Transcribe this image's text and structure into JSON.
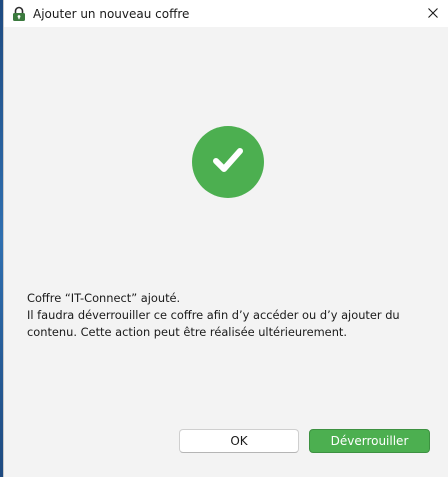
{
  "window": {
    "title": "Ajouter un nouveau coffre",
    "app_icon": "keepass-lock-icon",
    "close_icon": "close-icon"
  },
  "status": {
    "icon": "checkmark-icon",
    "color": "#4caf50"
  },
  "message": {
    "line1": "Coffre “IT-Connect” ajouté.",
    "line2": "Il faudra déverrouiller ce coffre afin d’y accéder ou d’y ajouter du",
    "line3": "contenu. Cette action peut être réalisée ultérieurement."
  },
  "buttons": {
    "ok_label": "OK",
    "unlock_label": "Déverrouiller",
    "primary_color": "#4caf50"
  }
}
